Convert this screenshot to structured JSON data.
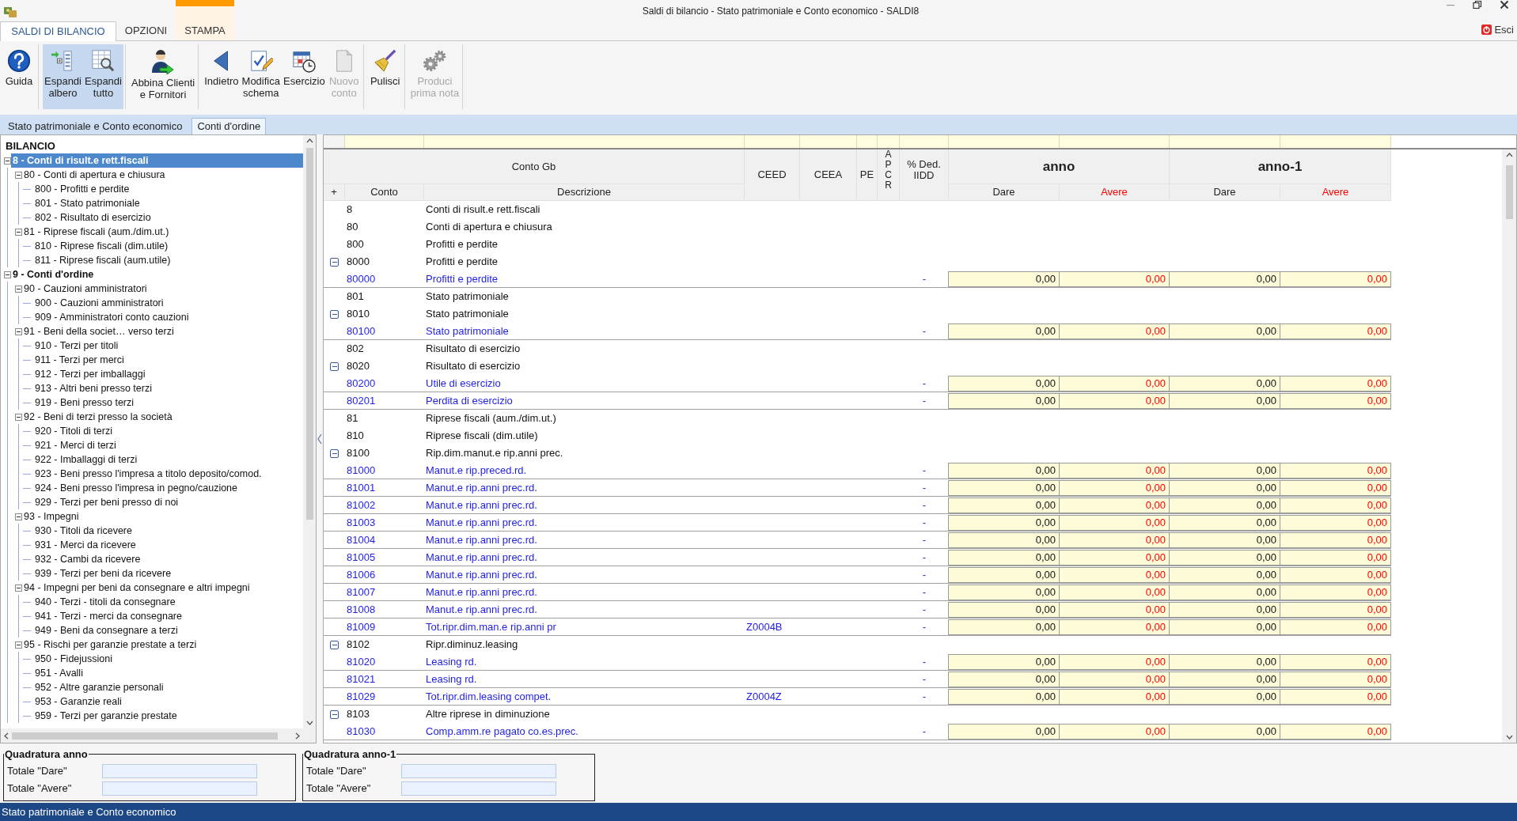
{
  "window": {
    "title": "Saldi di bilancio - Stato patrimoniale e Conto economico - SALDI8"
  },
  "ribbon_tabs": [
    {
      "label": "SALDI DI BILANCIO",
      "selected": true,
      "contextual": false
    },
    {
      "label": "OPZIONI",
      "selected": false,
      "contextual": false
    },
    {
      "label": "STAMPA",
      "selected": false,
      "contextual": true
    }
  ],
  "exit_label": "Esci",
  "toolbar": {
    "groups": [
      [
        {
          "label": "Guida",
          "pressed": false,
          "disabled": false
        }
      ],
      [
        {
          "label": "Espandi\nalbero",
          "pressed": true,
          "disabled": false
        },
        {
          "label": "Espandi\ntutto",
          "pressed": true,
          "disabled": false
        }
      ],
      [
        {
          "label": "Abbina Clienti\ne Fornitori",
          "pressed": false,
          "disabled": false
        }
      ],
      [
        {
          "label": "Indietro",
          "pressed": false,
          "disabled": false
        },
        {
          "label": "Modifica\nschema",
          "pressed": false,
          "disabled": false
        },
        {
          "label": "Esercizio",
          "pressed": false,
          "disabled": false
        },
        {
          "label": "Nuovo\nconto",
          "pressed": false,
          "disabled": true
        }
      ],
      [
        {
          "label": "Pulisci",
          "pressed": false,
          "disabled": false
        }
      ],
      [
        {
          "label": "Produci\nprima nota",
          "pressed": false,
          "disabled": true
        }
      ]
    ]
  },
  "document_tabs": [
    {
      "label": "Stato patrimoniale e Conto economico",
      "selected": false
    },
    {
      "label": "Conti d'ordine",
      "selected": true
    }
  ],
  "tree": {
    "title": "BILANCIO",
    "nodes": [
      {
        "label": "8 - Conti di risult.e rett.fiscali",
        "selected": true,
        "expanded": true,
        "children": [
          {
            "label": "80 - Conti di apertura e chiusura",
            "selected": false,
            "expanded": true,
            "children": [
              {
                "label": "800 - Profitti e perdite",
                "selected": false
              },
              {
                "label": "801 - Stato patrimoniale",
                "selected": false
              },
              {
                "label": "802 - Risultato di esercizio",
                "selected": false
              }
            ]
          },
          {
            "label": "81 - Riprese fiscali (aum./dim.ut.)",
            "selected": false,
            "expanded": true,
            "children": [
              {
                "label": "810 - Riprese fiscali (dim.utile)",
                "selected": false
              },
              {
                "label": "811 - Riprese fiscali (aum.utile)",
                "selected": false
              }
            ]
          }
        ]
      },
      {
        "label": "9 - Conti d'ordine",
        "selected": false,
        "expanded": true,
        "children": [
          {
            "label": "90 - Cauzioni amministratori",
            "selected": false,
            "expanded": true,
            "children": [
              {
                "label": "900 - Cauzioni amministratori",
                "selected": false
              },
              {
                "label": "909 - Amministratori conto cauzioni",
                "selected": false
              }
            ]
          },
          {
            "label": "91 - Beni della societ… verso terzi",
            "selected": false,
            "expanded": true,
            "children": [
              {
                "label": "910 - Terzi per titoli",
                "selected": false
              },
              {
                "label": "911 - Terzi per merci",
                "selected": false
              },
              {
                "label": "912 - Terzi per imballaggi",
                "selected": false
              },
              {
                "label": "913 - Altri beni presso terzi",
                "selected": false
              },
              {
                "label": "919 - Beni presso terzi",
                "selected": false
              }
            ]
          },
          {
            "label": "92 - Beni di terzi presso la società",
            "selected": false,
            "expanded": true,
            "children": [
              {
                "label": "920 - Titoli di terzi",
                "selected": false
              },
              {
                "label": "921 - Merci di terzi",
                "selected": false
              },
              {
                "label": "922 - Imballaggi di terzi",
                "selected": false
              },
              {
                "label": "923 - Beni presso l'impresa a titolo deposito/comod.",
                "selected": false
              },
              {
                "label": "924 - Beni presso l'impresa in pegno/cauzione",
                "selected": false
              },
              {
                "label": "929 - Terzi per beni presso di noi",
                "selected": false
              }
            ]
          },
          {
            "label": "93 - Impegni",
            "selected": false,
            "expanded": true,
            "children": [
              {
                "label": "930 - Titoli da ricevere",
                "selected": false
              },
              {
                "label": "931 - Merci da ricevere",
                "selected": false
              },
              {
                "label": "932 - Cambi da ricevere",
                "selected": false
              },
              {
                "label": "939 - Terzi per beni da ricevere",
                "selected": false
              }
            ]
          },
          {
            "label": "94 - Impegni per beni da consegnare e altri impegni",
            "selected": false,
            "expanded": true,
            "children": [
              {
                "label": "940 - Terzi - titoli da consegnare",
                "selected": false
              },
              {
                "label": "941 - Terzi - merci da consegnare",
                "selected": false
              },
              {
                "label": "949 - Beni da consegnare a terzi",
                "selected": false
              }
            ]
          },
          {
            "label": "95 - Rischi per garanzie prestate a terzi",
            "selected": false,
            "expanded": true,
            "children": [
              {
                "label": "950 - Fidejussioni",
                "selected": false
              },
              {
                "label": "951 - Avalli",
                "selected": false
              },
              {
                "label": "952 - Altre garanzie personali",
                "selected": false
              },
              {
                "label": "953 - Garanzie reali",
                "selected": false
              },
              {
                "label": "959 - Terzi per garanzie prestate",
                "selected": false
              }
            ]
          }
        ]
      }
    ]
  },
  "grid": {
    "header": {
      "group": "Conto Gb",
      "plus": "+",
      "conto": "Conto",
      "descrizione": "Descrizione",
      "ceed": "CEED",
      "ceea": "CEEA",
      "pe": "PE",
      "apcr": "APCR",
      "ded": "% Ded. IIDD",
      "anno": "anno",
      "anno_1": "anno-1",
      "dare": "Dare",
      "avere": "Avere",
      "dare_1": "Dare",
      "avere_1": "Avere"
    },
    "rows": [
      {
        "kind": "group",
        "conto": "8",
        "descrizione": "Conti di risult.e rett.fiscali"
      },
      {
        "kind": "group",
        "conto": "80",
        "descrizione": "Conti di apertura e chiusura"
      },
      {
        "kind": "group",
        "conto": "800",
        "descrizione": "Profitti e perdite"
      },
      {
        "kind": "group",
        "conto": "8000",
        "descrizione": "Profitti e perdite",
        "expanded": true
      },
      {
        "kind": "account",
        "conto": "80000",
        "descrizione": "Profitti e perdite",
        "ded": "-",
        "values": [
          "0,00",
          "0,00",
          "0,00",
          "0,00"
        ]
      },
      {
        "kind": "group",
        "conto": "801",
        "descrizione": "Stato patrimoniale"
      },
      {
        "kind": "group",
        "conto": "8010",
        "descrizione": "Stato patrimoniale",
        "expanded": true
      },
      {
        "kind": "account",
        "conto": "80100",
        "descrizione": "Stato patrimoniale",
        "ded": "-",
        "values": [
          "0,00",
          "0,00",
          "0,00",
          "0,00"
        ]
      },
      {
        "kind": "group",
        "conto": "802",
        "descrizione": "Risultato di esercizio"
      },
      {
        "kind": "group",
        "conto": "8020",
        "descrizione": "Risultato di esercizio",
        "expanded": true
      },
      {
        "kind": "account",
        "conto": "80200",
        "descrizione": "Utile di esercizio",
        "ded": "-",
        "values": [
          "0,00",
          "0,00",
          "0,00",
          "0,00"
        ]
      },
      {
        "kind": "account",
        "conto": "80201",
        "descrizione": "Perdita di esercizio",
        "ded": "-",
        "values": [
          "0,00",
          "0,00",
          "0,00",
          "0,00"
        ]
      },
      {
        "kind": "group",
        "conto": "81",
        "descrizione": "Riprese fiscali (aum./dim.ut.)"
      },
      {
        "kind": "group",
        "conto": "810",
        "descrizione": "Riprese fiscali (dim.utile)"
      },
      {
        "kind": "group",
        "conto": "8100",
        "descrizione": "Rip.dim.manut.e rip.anni prec.",
        "expanded": true
      },
      {
        "kind": "account",
        "conto": "81000",
        "descrizione": "Manut.e rip.preced.rd.",
        "ded": "-",
        "values": [
          "0,00",
          "0,00",
          "0,00",
          "0,00"
        ]
      },
      {
        "kind": "account",
        "conto": "81001",
        "descrizione": "Manut.e rip.anni prec.rd.",
        "ded": "-",
        "values": [
          "0,00",
          "0,00",
          "0,00",
          "0,00"
        ]
      },
      {
        "kind": "account",
        "conto": "81002",
        "descrizione": "Manut.e rip.anni prec.rd.",
        "ded": "-",
        "values": [
          "0,00",
          "0,00",
          "0,00",
          "0,00"
        ]
      },
      {
        "kind": "account",
        "conto": "81003",
        "descrizione": "Manut.e rip.anni prec.rd.",
        "ded": "-",
        "values": [
          "0,00",
          "0,00",
          "0,00",
          "0,00"
        ]
      },
      {
        "kind": "account",
        "conto": "81004",
        "descrizione": "Manut.e rip.anni prec.rd.",
        "ded": "-",
        "values": [
          "0,00",
          "0,00",
          "0,00",
          "0,00"
        ]
      },
      {
        "kind": "account",
        "conto": "81005",
        "descrizione": "Manut.e rip.anni prec.rd.",
        "ded": "-",
        "values": [
          "0,00",
          "0,00",
          "0,00",
          "0,00"
        ]
      },
      {
        "kind": "account",
        "conto": "81006",
        "descrizione": "Manut.e rip.anni prec.rd.",
        "ded": "-",
        "values": [
          "0,00",
          "0,00",
          "0,00",
          "0,00"
        ]
      },
      {
        "kind": "account",
        "conto": "81007",
        "descrizione": "Manut.e rip.anni prec.rd.",
        "ded": "-",
        "values": [
          "0,00",
          "0,00",
          "0,00",
          "0,00"
        ]
      },
      {
        "kind": "account",
        "conto": "81008",
        "descrizione": "Manut.e rip.anni prec.rd.",
        "ded": "-",
        "values": [
          "0,00",
          "0,00",
          "0,00",
          "0,00"
        ]
      },
      {
        "kind": "account",
        "conto": "81009",
        "descrizione": "Tot.ripr.dim.man.e rip.anni pr",
        "ceed": "Z0004B",
        "ded": "-",
        "values": [
          "0,00",
          "0,00",
          "0,00",
          "0,00"
        ]
      },
      {
        "kind": "group",
        "conto": "8102",
        "descrizione": "Ripr.diminuz.leasing",
        "expanded": true
      },
      {
        "kind": "account",
        "conto": "81020",
        "descrizione": "Leasing rd.",
        "ded": "-",
        "values": [
          "0,00",
          "0,00",
          "0,00",
          "0,00"
        ]
      },
      {
        "kind": "account",
        "conto": "81021",
        "descrizione": "Leasing rd.",
        "ded": "-",
        "values": [
          "0,00",
          "0,00",
          "0,00",
          "0,00"
        ]
      },
      {
        "kind": "account",
        "conto": "81029",
        "descrizione": "Tot.ripr.dim.leasing compet.",
        "ceed": "Z0004Z",
        "ded": "-",
        "values": [
          "0,00",
          "0,00",
          "0,00",
          "0,00"
        ]
      },
      {
        "kind": "group",
        "conto": "8103",
        "descrizione": "Altre riprese in diminuzione",
        "expanded": true
      },
      {
        "kind": "account",
        "conto": "81030",
        "descrizione": "Comp.amm.re pagato co.es.prec.",
        "ded": "-",
        "values": [
          "0,00",
          "0,00",
          "0,00",
          "0,00"
        ]
      }
    ]
  },
  "quadrature": [
    {
      "title": "Quadratura anno",
      "fields": [
        {
          "label": "Totale \"Dare\""
        },
        {
          "label": "Totale \"Avere\""
        }
      ]
    },
    {
      "title": "Quadratura anno-1",
      "fields": [
        {
          "label": "Totale \"Dare\""
        },
        {
          "label": "Totale \"Avere\""
        }
      ]
    }
  ],
  "status_bar": "Stato patrimoniale e Conto economico"
}
